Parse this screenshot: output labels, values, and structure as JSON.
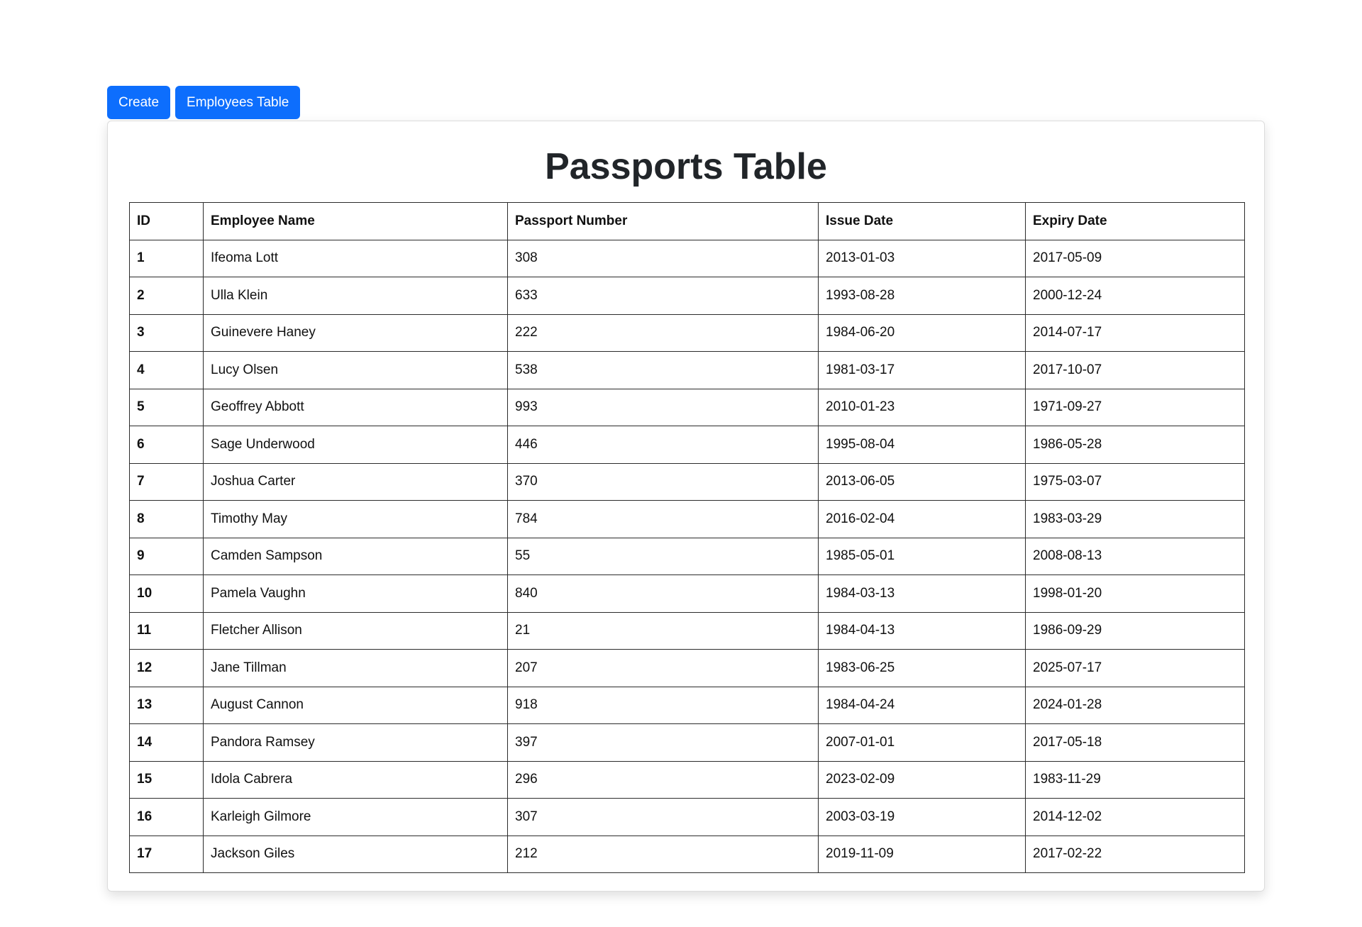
{
  "toolbar": {
    "create_label": "Create",
    "employees_table_label": "Employees Table"
  },
  "page": {
    "title": "Passports Table"
  },
  "table": {
    "columns": [
      "ID",
      "Employee Name",
      "Passport Number",
      "Issue Date",
      "Expiry Date"
    ],
    "rows": [
      [
        "1",
        "Ifeoma Lott",
        "308",
        "2013-01-03",
        "2017-05-09"
      ],
      [
        "2",
        "Ulla Klein",
        "633",
        "1993-08-28",
        "2000-12-24"
      ],
      [
        "3",
        "Guinevere Haney",
        "222",
        "1984-06-20",
        "2014-07-17"
      ],
      [
        "4",
        "Lucy Olsen",
        "538",
        "1981-03-17",
        "2017-10-07"
      ],
      [
        "5",
        "Geoffrey Abbott",
        "993",
        "2010-01-23",
        "1971-09-27"
      ],
      [
        "6",
        "Sage Underwood",
        "446",
        "1995-08-04",
        "1986-05-28"
      ],
      [
        "7",
        "Joshua Carter",
        "370",
        "2013-06-05",
        "1975-03-07"
      ],
      [
        "8",
        "Timothy May",
        "784",
        "2016-02-04",
        "1983-03-29"
      ],
      [
        "9",
        "Camden Sampson",
        "55",
        "1985-05-01",
        "2008-08-13"
      ],
      [
        "10",
        "Pamela Vaughn",
        "840",
        "1984-03-13",
        "1998-01-20"
      ],
      [
        "11",
        "Fletcher Allison",
        "21",
        "1984-04-13",
        "1986-09-29"
      ],
      [
        "12",
        "Jane Tillman",
        "207",
        "1983-06-25",
        "2025-07-17"
      ],
      [
        "13",
        "August Cannon",
        "918",
        "1984-04-24",
        "2024-01-28"
      ],
      [
        "14",
        "Pandora Ramsey",
        "397",
        "2007-01-01",
        "2017-05-18"
      ],
      [
        "15",
        "Idola Cabrera",
        "296",
        "2023-02-09",
        "1983-11-29"
      ],
      [
        "16",
        "Karleigh Gilmore",
        "307",
        "2003-03-19",
        "2014-12-02"
      ],
      [
        "17",
        "Jackson Giles",
        "212",
        "2019-11-09",
        "2017-02-22"
      ]
    ]
  },
  "colors": {
    "primary_button": "#0d6efd",
    "title_text": "#212529",
    "table_border": "#2b2b2b"
  }
}
